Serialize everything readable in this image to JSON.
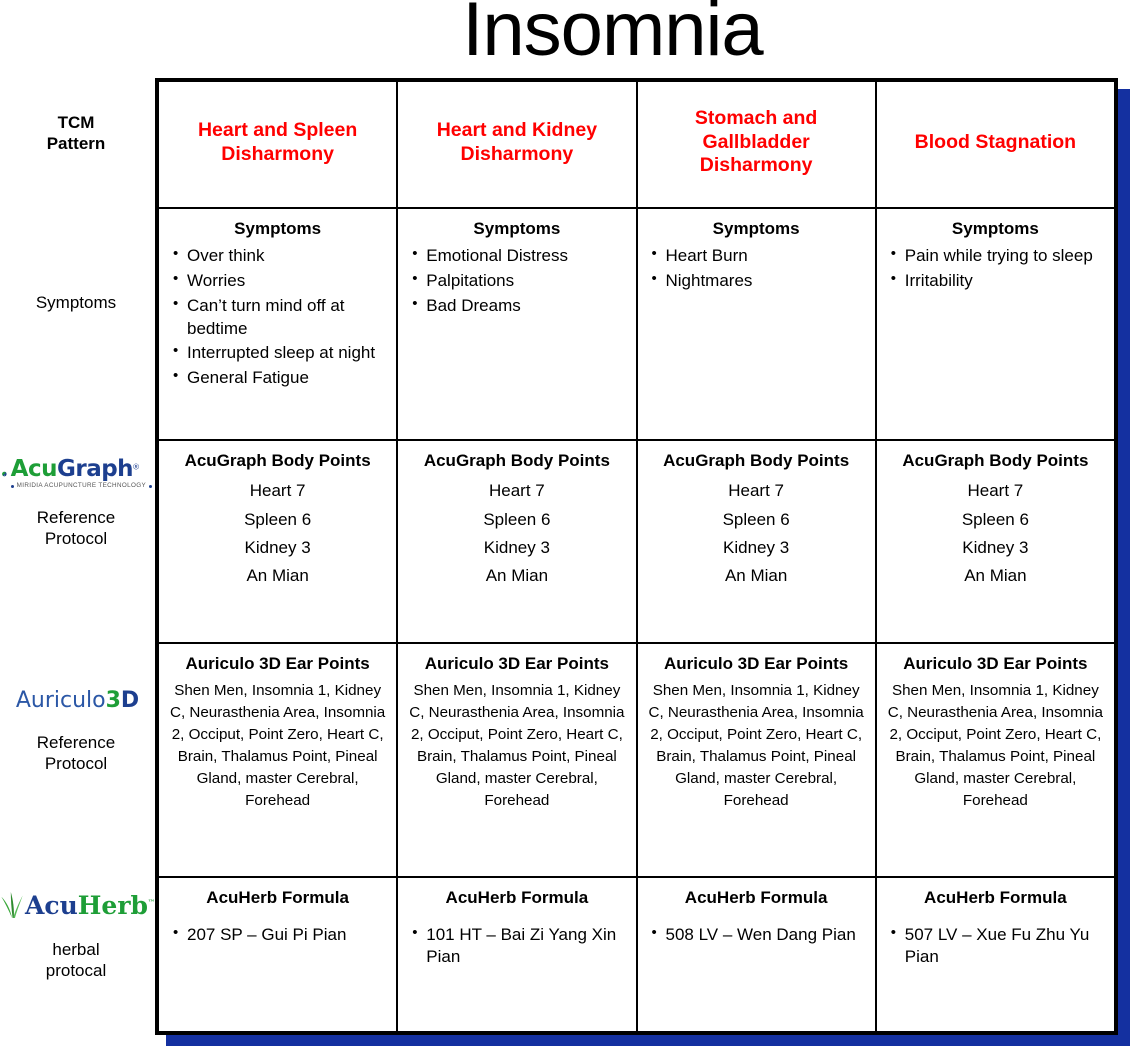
{
  "title": "Insomnia",
  "row_labels": {
    "tcm_pattern": "TCM\nPattern",
    "tcm_pattern_line1": "TCM",
    "tcm_pattern_line2": "Pattern",
    "symptoms": "Symptoms",
    "acugraph_ref_line1": "Reference",
    "acugraph_ref_line2": "Protocol",
    "auriculo_ref_line1": "Reference",
    "auriculo_ref_line2": "Protocol",
    "acuherb_ref_line1": "herbal",
    "acuherb_ref_line2": "protocal"
  },
  "logos": {
    "acugraph": {
      "name": "acugraph-logo",
      "word_part1": "Acu",
      "word_part2": "Graph",
      "trademark": "®",
      "tagline": "MIRIDIA ACUPUNCTURE TECHNOLOGY",
      "color_green": "#1e9e37",
      "color_blue": "#1d3f8f"
    },
    "auriculo3d": {
      "name": "auriculo3d-logo",
      "word_part1": "Auriculo",
      "word_part2": "3",
      "word_part3": "D",
      "color_blue": "#2b57a6",
      "color_green": "#1e9e37"
    },
    "acuherb": {
      "name": "acuherb-logo",
      "word_part1": "Acu",
      "word_part2": "Herb",
      "trademark": "™",
      "color_blue": "#1d3f8f",
      "color_green": "#1e9e37"
    }
  },
  "section_headings": {
    "symptoms": "Symptoms",
    "body_points": "AcuGraph Body Points",
    "ear_points": "Auriculo 3D Ear Points",
    "herb_formula": "AcuHerb Formula"
  },
  "colors": {
    "pattern_text": "#ff0000",
    "table_border": "#000000",
    "shadow": "#1430a0",
    "background": "#ffffff"
  },
  "columns": [
    {
      "pattern": "Heart and Spleen Disharmony",
      "symptoms_heading": "Symptoms",
      "symptoms": [
        "Over think",
        "Worries",
        "Can’t turn mind off at bedtime",
        "Interrupted sleep at night",
        "General Fatigue"
      ],
      "body_heading": "AcuGraph Body Points",
      "body_points": [
        "Heart 7",
        "Spleen 6",
        "Kidney 3",
        "An Mian"
      ],
      "ear_heading": "Auriculo 3D Ear Points",
      "ear_points": "Shen Men, Insomnia 1, Kidney C, Neurasthenia Area, Insomnia 2, Occiput, Point Zero, Heart C, Brain, Thalamus Point, Pineal Gland, master Cerebral, Forehead",
      "herb_heading": "AcuHerb Formula",
      "herb_formulas": [
        "207 SP – Gui Pi Pian"
      ]
    },
    {
      "pattern": "Heart and Kidney Disharmony",
      "symptoms_heading": "Symptoms",
      "symptoms": [
        "Emotional Distress",
        "Palpitations",
        "Bad Dreams"
      ],
      "body_heading": "AcuGraph Body Points",
      "body_points": [
        "Heart 7",
        "Spleen 6",
        "Kidney 3",
        "An Mian"
      ],
      "ear_heading": "Auriculo 3D Ear Points",
      "ear_points": "Shen Men, Insomnia 1, Kidney C, Neurasthenia Area, Insomnia 2, Occiput, Point Zero, Heart C, Brain, Thalamus Point, Pineal Gland, master Cerebral, Forehead",
      "herb_heading": "AcuHerb Formula",
      "herb_formulas": [
        "101 HT – Bai Zi Yang Xin Pian"
      ]
    },
    {
      "pattern": "Stomach and Gallbladder Disharmony",
      "symptoms_heading": "Symptoms",
      "symptoms": [
        "Heart Burn",
        "Nightmares"
      ],
      "body_heading": "AcuGraph Body Points",
      "body_points": [
        "Heart 7",
        "Spleen 6",
        "Kidney 3",
        "An Mian"
      ],
      "ear_heading": "Auriculo 3D Ear Points",
      "ear_points": "Shen Men, Insomnia 1, Kidney C, Neurasthenia Area, Insomnia 2, Occiput, Point Zero, Heart C, Brain, Thalamus Point, Pineal Gland, master Cerebral, Forehead",
      "herb_heading": "AcuHerb Formula",
      "herb_formulas": [
        "508 LV – Wen Dang Pian"
      ]
    },
    {
      "pattern": "Blood Stagnation",
      "symptoms_heading": "Symptoms",
      "symptoms": [
        "Pain while trying to sleep",
        "Irritability"
      ],
      "body_heading": "AcuGraph Body Points",
      "body_points": [
        "Heart 7",
        "Spleen 6",
        "Kidney 3",
        "An Mian"
      ],
      "ear_heading": "Auriculo 3D Ear Points",
      "ear_points": "Shen Men, Insomnia 1, Kidney C, Neurasthenia Area, Insomnia 2, Occiput, Point Zero, Heart C, Brain, Thalamus Point, Pineal Gland, master Cerebral, Forehead",
      "herb_heading": "AcuHerb Formula",
      "herb_formulas": [
        "507 LV – Xue Fu Zhu Yu Pian"
      ]
    }
  ]
}
